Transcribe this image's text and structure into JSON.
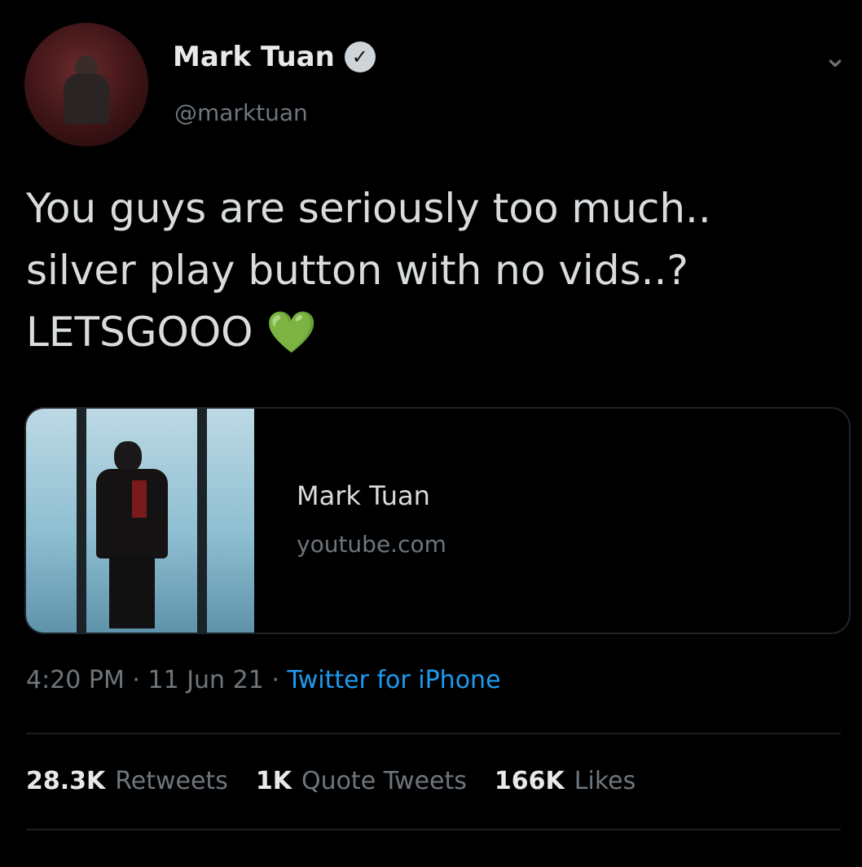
{
  "author": {
    "name": "Mark Tuan",
    "handle": "@marktuan",
    "verified_glyph": "✓"
  },
  "menu_icon": "chevron-down-icon",
  "tweet": {
    "text": "You guys are seriously too much..\nsilver play button with no vids..?\nLETSGOOO",
    "emoji": "💚"
  },
  "link_card": {
    "title": "Mark Tuan",
    "domain": "youtube.com"
  },
  "meta": {
    "timestamp": "4:20 PM · 11 Jun 21 · ",
    "source": "Twitter for iPhone"
  },
  "stats": {
    "retweets_count": "28.3K",
    "retweets_label": "Retweets",
    "quotes_count": "1K",
    "quotes_label": "Quote Tweets",
    "likes_count": "166K",
    "likes_label": "Likes"
  },
  "colors": {
    "background": "#000000",
    "link_blue": "#1d9bf0",
    "heart_green": "#77b255"
  }
}
